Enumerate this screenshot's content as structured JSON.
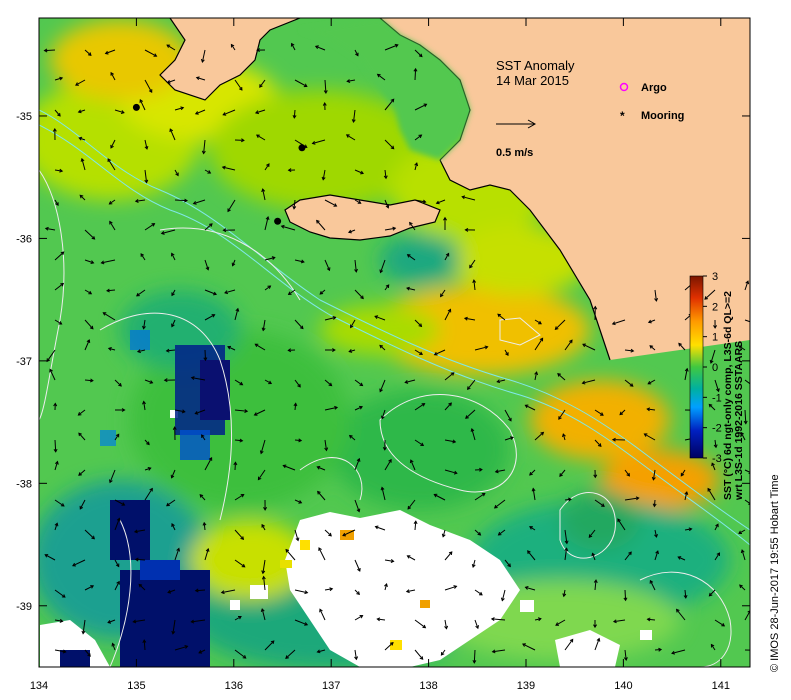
{
  "map": {
    "title": "SST Anomaly",
    "date": "14 Mar 2015",
    "scale_label": "0.5 m/s",
    "legend": {
      "argo_label": "Argo",
      "mooring_label": "Mooring"
    },
    "x_ticks": [
      "134",
      "135",
      "136",
      "137",
      "138",
      "139",
      "140",
      "141"
    ],
    "y_ticks": [
      "-35",
      "-36",
      "-37",
      "-38",
      "-39"
    ],
    "lon_range": [
      134,
      141.3
    ],
    "lat_range": [
      -34.2,
      -39.5
    ],
    "moorings": [
      {
        "lon": 135.0,
        "lat": -34.93
      },
      {
        "lon": 136.7,
        "lat": -35.26
      },
      {
        "lon": 136.45,
        "lat": -35.86
      }
    ]
  },
  "colorbar": {
    "ticks": [
      "3",
      "2",
      "1",
      "0",
      "-1",
      "-2",
      "-3"
    ],
    "caption_lines": [
      "SST (°C) 6d ngt-only comp, L3S-6d QL>=2",
      "wrt L3S-1d 1992-2016 SSTAARS"
    ],
    "colors": [
      "#8b1a00",
      "#ff5a00",
      "#ffc000",
      "#c8e800",
      "#38c838",
      "#00a0ff",
      "#0000a0",
      "#000060"
    ]
  },
  "credit": "©  IMOS 28-Jun-2017 19:55 Hobart Time",
  "colors": {
    "land": "#f9c89b",
    "ocean_base": "#4cc94c",
    "cloud": "#ffffff",
    "contour": "#e8e8e8",
    "shelf": "#7fe8e8"
  }
}
